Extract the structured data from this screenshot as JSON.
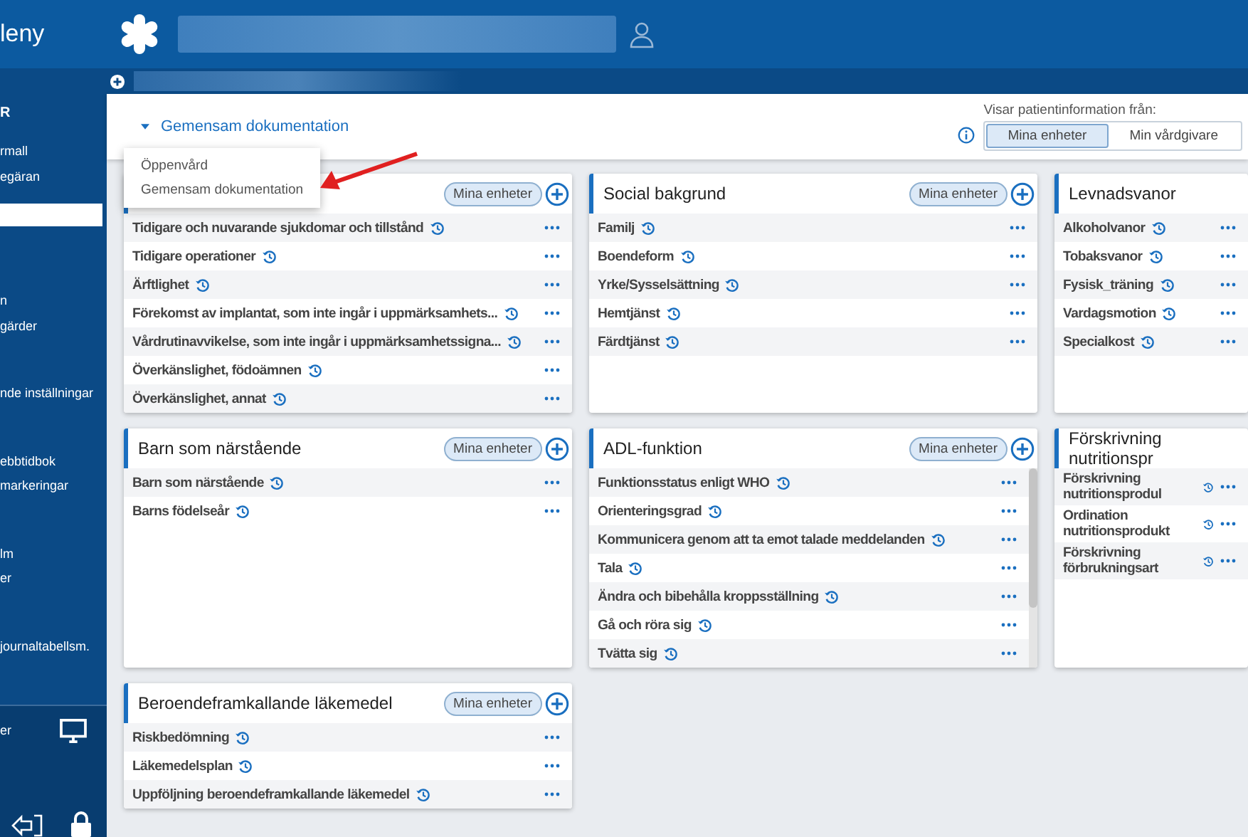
{
  "top_bar": {
    "menu_label": "leny"
  },
  "sidebar": {
    "heading": "R",
    "groups": [
      [
        "rmall",
        "egäran"
      ],
      [
        "n",
        "gärder"
      ],
      [
        "nde inställningar"
      ],
      [
        "ebbtidbok",
        "markeringar"
      ],
      [
        "lm",
        "er"
      ],
      [
        "journaltabellsm."
      ]
    ],
    "footer_label": "er"
  },
  "header": {
    "view_label": "Gemensam dokumentation",
    "source_label": "Visar patientinformation från:",
    "source_options": [
      {
        "label": "Mina enheter",
        "selected": true
      },
      {
        "label": "Min vårdgivare",
        "selected": false
      }
    ]
  },
  "dropdown_menu": {
    "items": [
      "Öppenvård",
      "Gemensam dokumentation"
    ]
  },
  "cards": [
    {
      "filter": "Mina enheter",
      "rows": [
        "Tidigare och nuvarande sjukdomar och tillstånd",
        "Tidigare operationer",
        "Ärftlighet",
        "Förekomst av implantat, som inte ingår i uppmärksamhets...",
        "Vårdrutinavvikelse, som inte ingår i uppmärksamhetssigna...",
        "Överkänslighet, födoämnen",
        "Överkänslighet, annat"
      ]
    },
    {
      "title": "Social bakgrund",
      "filter": "Mina enheter",
      "rows": [
        "Familj",
        "Boendeform",
        "Yrke/Sysselsättning",
        "Hemtjänst",
        "Färdtjänst"
      ]
    },
    {
      "title": "Levnadsvanor",
      "rows": [
        "Alkoholvanor",
        "Tobaksvanor",
        "Fysisk_träning",
        "Vardagsmotion",
        "Specialkost"
      ]
    },
    {
      "title": "Barn som närstående",
      "filter": "Mina enheter",
      "rows": [
        "Barn som närstående",
        "Barns födelseår"
      ]
    },
    {
      "title": "ADL-funktion",
      "filter": "Mina enheter",
      "scrollable": true,
      "rows": [
        "Funktionsstatus enligt WHO",
        "Orienteringsgrad",
        "Kommunicera genom att ta emot talade meddelanden",
        "Tala",
        "Ändra och bibehålla kroppsställning",
        "Gå och röra sig",
        "Tvätta sig"
      ]
    },
    {
      "title": "Förskrivning nutritionspr",
      "rows": [
        "Förskrivning nutritionsprodul",
        "Ordination nutritionsprodukt",
        "Förskrivning förbrukningsart"
      ]
    },
    {
      "title": "Beroendeframkallande läkemedel",
      "filter": "Mina enheter",
      "rows": [
        "Riskbedömning",
        "Läkemedelsplan",
        "Uppföljning beroendeframkallande läkemedel"
      ]
    }
  ]
}
